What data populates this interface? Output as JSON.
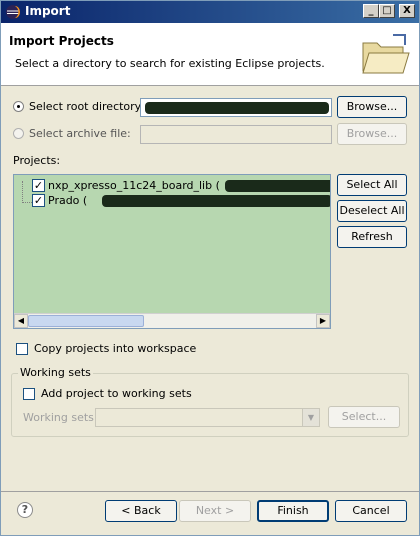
{
  "window": {
    "title": "Import",
    "min_glyph": "_",
    "max_glyph": "□",
    "close_glyph": "X"
  },
  "banner": {
    "heading": "Import Projects",
    "description": "Select a directory to search for existing Eclipse projects."
  },
  "source": {
    "root_directory_label": "Select root directory:",
    "archive_file_label": "Select archive file:",
    "browse_root_label": "Browse...",
    "browse_archive_label": "Browse..."
  },
  "projects": {
    "label": "Projects:",
    "items": [
      {
        "name": "nxp_xpresso_11c24_board_lib (",
        "checked": true
      },
      {
        "name": "Prado (",
        "checked": true
      }
    ],
    "select_all_label": "Select All",
    "deselect_all_label": "Deselect All",
    "refresh_label": "Refresh"
  },
  "options": {
    "copy_label": "Copy projects into workspace"
  },
  "working_sets": {
    "group_title": "Working sets",
    "add_label": "Add project to working sets",
    "field_label": "Working sets:",
    "select_label": "Select..."
  },
  "footer": {
    "help_glyph": "?",
    "back_label": "< Back",
    "next_label": "Next >",
    "finish_label": "Finish",
    "cancel_label": "Cancel"
  },
  "colors": {
    "titlebar_start": "#0a246a",
    "titlebar_end": "#3a6ea5",
    "list_background": "#b7d7b0",
    "checkmark": "#21a121"
  }
}
